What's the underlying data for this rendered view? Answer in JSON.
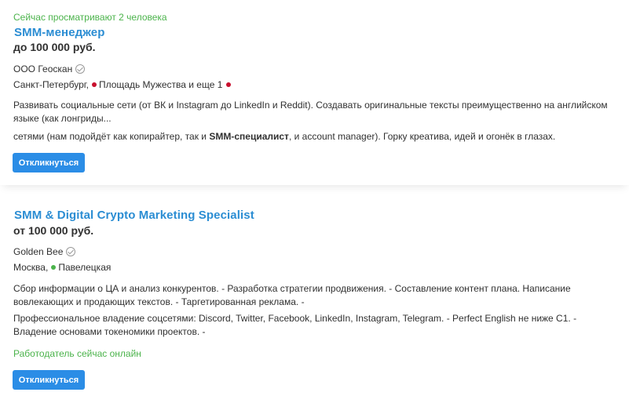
{
  "vacancies": [
    {
      "viewers": "Сейчас просматривают 2 человека",
      "title": "SMM-менеджер",
      "salary": "до 100 000 руб.",
      "company": "ООО Геоскан",
      "city": "Санкт-Петербург,",
      "metro": "Площадь Мужества и еще 1",
      "metro_color": "#c8102e",
      "desc1": "Развивать социальные сети (от ВК и Instagram до LinkedIn и Reddit). Создавать оригинальные тексты преимущественно на английском языке (как лонгриды...",
      "desc2_before": "сетями (нам подойдёт как копирайтер, так и ",
      "desc2_bold": "SMM-специалист",
      "desc2_after": ", и account manager). Горку креатива, идей и огонёк в глазах.",
      "button": "Откликнуться"
    },
    {
      "title": "SMM & Digital Crypto Marketing Specialist",
      "salary": "от 100 000 руб.",
      "company": "Golden Bee",
      "city": "Москва,",
      "metro": "Павелецкая",
      "metro_color": "#4bb34b",
      "desc1": "Сбор информации о ЦА и анализ конкурентов. - Разработка стратегии продвижения. - Составление контент плана. Написание вовлекающих и продающих текстов. - Таргетированная реклама. -",
      "desc2": "Профессиональное владение соцсетями: Discord, Twitter, Facebook, LinkedIn, Instagram, Telegram. - Perfect English не ниже С1. - Владение основами токеномики проектов. -",
      "online": "Работодатель сейчас онлайн",
      "button": "Откликнуться"
    }
  ]
}
